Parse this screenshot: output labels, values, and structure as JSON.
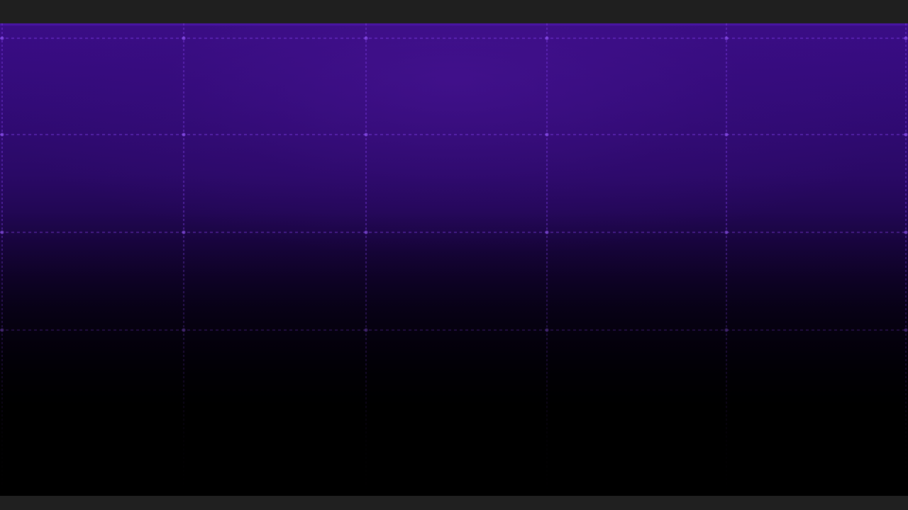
{
  "colors": {
    "frame": "#1f1f1f",
    "gradient_top": "#3a0d86",
    "gradient_bottom": "#000000",
    "grid_line": "#7a3ae0",
    "grid_node": "#9a5cff"
  }
}
